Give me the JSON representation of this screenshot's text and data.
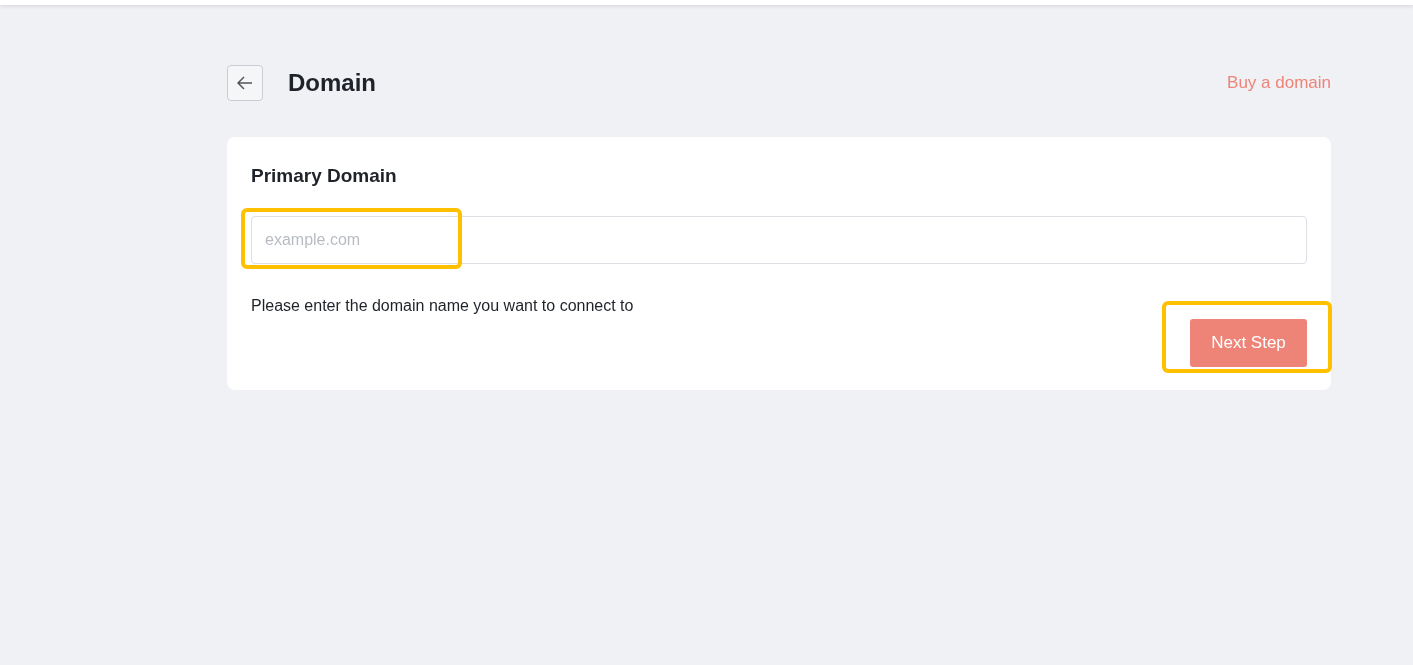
{
  "header": {
    "title": "Domain",
    "link": "Buy a domain"
  },
  "card": {
    "title": "Primary Domain",
    "field": {
      "placeholder": "example.com"
    },
    "hint": "Please enter the domain name you want to connect to",
    "button": "Next Step"
  }
}
